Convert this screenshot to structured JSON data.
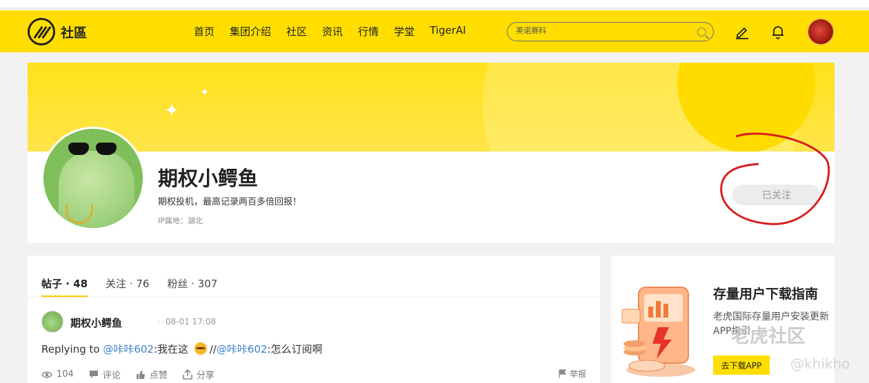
{
  "header": {
    "logo_text": "社區",
    "nav": [
      "首页",
      "集团介绍",
      "社区",
      "资讯",
      "行情",
      "学堂",
      "TigerAI"
    ],
    "search_placeholder": "英诺赛科"
  },
  "profile": {
    "name": "期权小鳄鱼",
    "bio": "期权投机，最高记录两百多倍回报！",
    "ip": "IP属地：湖北",
    "follow_label": "已关注"
  },
  "tabs": [
    {
      "label": "帖子 · 48",
      "active": true
    },
    {
      "label": "关注 · 76",
      "active": false
    },
    {
      "label": "粉丝 · 307",
      "active": false
    }
  ],
  "post": {
    "author": "期权小鳄鱼",
    "time": "08-01 17:08",
    "text_prefix": "Replying to ",
    "mention1": "@咔咔602",
    "text_mid": ":我在这 ",
    "text_sep": "//",
    "mention2": "@咔咔602",
    "text_end": ":怎么订阅啊",
    "views": "104",
    "comment_label": "评论",
    "like_label": "点赞",
    "share_label": "分享",
    "report_label": "举报"
  },
  "side": {
    "title": "存量用户下载指南",
    "desc": "老虎国际存量用户安装更新APP指引",
    "button": "去下载APP"
  },
  "watermark": {
    "main": "老虎社区",
    "handle": "@khikho"
  }
}
